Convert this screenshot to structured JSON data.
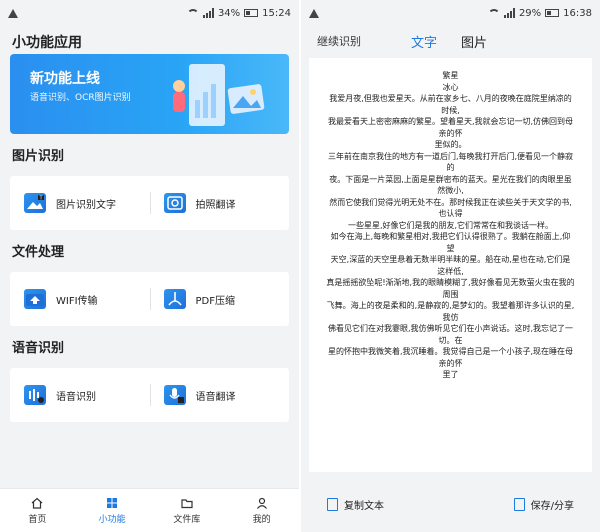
{
  "left": {
    "status": {
      "battery": "34%",
      "time": "15:24"
    },
    "title": "小功能应用",
    "banner": {
      "title": "新功能上线",
      "subtitle": "语音识别、OCR图片识别"
    },
    "sections": [
      {
        "title": "图片识别",
        "items": [
          {
            "label": "图片识别文字",
            "icon": "image-text-icon"
          },
          {
            "label": "拍照翻译",
            "icon": "camera-translate-icon"
          }
        ]
      },
      {
        "title": "文件处理",
        "items": [
          {
            "label": "WIFI传输",
            "icon": "wifi-transfer-icon"
          },
          {
            "label": "PDF压缩",
            "icon": "pdf-compress-icon"
          }
        ]
      },
      {
        "title": "语音识别",
        "items": [
          {
            "label": "语音识别",
            "icon": "voice-recognize-icon"
          },
          {
            "label": "语音翻译",
            "icon": "voice-translate-icon"
          }
        ]
      }
    ],
    "tabs": [
      {
        "label": "首页",
        "icon": "home-icon",
        "active": false
      },
      {
        "label": "小功能",
        "icon": "grid-icon",
        "active": true
      },
      {
        "label": "文件库",
        "icon": "folder-icon",
        "active": false
      },
      {
        "label": "我的",
        "icon": "user-icon",
        "active": false
      }
    ],
    "accent": "#1f7ae0"
  },
  "right": {
    "status": {
      "battery": "29%",
      "time": "16:38"
    },
    "nav": {
      "continue": "继续识别",
      "text_tab": "文字",
      "image_tab": "图片"
    },
    "ocr_lines": [
      "繁星",
      "冰心",
      "我爱月夜,但我也爱星天。从前在家乡七、八月的夜晚在庭院里纳凉的",
      "时候,",
      "我最爱看天上密密麻麻的繁星。望着星天,我就会忘记一切,仿佛回到母",
      "亲的怀",
      "里似的。",
      "三年前在南京我住的地方有一道后门,每晚我打开后门,便看见一个静寂",
      "的",
      "夜。下面是一片菜园,上面是星群密布的蓝天。星光在我们的肉眼里虽",
      "然微小,",
      "然而它使我们觉得光明无处不在。那时候我正在读些关于天文学的书,",
      "也认得",
      "一些星星,好像它们是我的朋友,它们常常在和我谈话一样。",
      "如今在海上,每晚和繁星相对,我把它们认得很熟了。我躺在舱面上,仰",
      "望",
      "天空,深蓝的天空里悬着无数半明半昧的星。船在动,星也在动,它们是",
      "这样低,",
      "真是摇摇欲坠呢!渐渐地,我的眼睛模糊了,我好像看见无数萤火虫在我的",
      "周围",
      "飞舞。海上的夜是柔和的,是静寂的,是梦幻的。我望着那许多认识的星,",
      "我仿",
      "佛看见它们在对我霎眼,我仿佛听见它们在小声说话。这时,我忘记了一",
      "切。在",
      "星的怀抱中我微笑着,我沉睡着。我觉得自己是一个小孩子,现在睡在母",
      "亲的怀",
      "里了"
    ],
    "actions": {
      "copy": "复制文本",
      "save": "保存/分享"
    }
  }
}
